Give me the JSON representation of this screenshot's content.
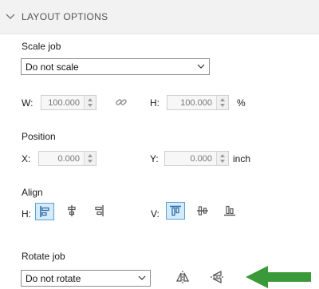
{
  "section": {
    "title": "LAYOUT OPTIONS"
  },
  "scale": {
    "label": "Scale job",
    "select_value": "Do not scale",
    "w_label": "W:",
    "w_value": "100.000",
    "h_label": "H:",
    "h_value": "100.000",
    "unit": "%"
  },
  "position": {
    "label": "Position",
    "x_label": "X:",
    "x_value": "0.000",
    "y_label": "Y:",
    "y_value": "0.000",
    "unit": "inch"
  },
  "align": {
    "label": "Align",
    "h_label": "H:",
    "v_label": "V:"
  },
  "rotate": {
    "label": "Rotate job",
    "select_value": "Do not rotate"
  },
  "colors": {
    "accent": "#3a9a3a",
    "active_fill": "#d6ebfa",
    "icon_blue": "#2f6fa8"
  },
  "icons": {
    "collapse": "chevron-down-icon",
    "link": "chain-link-icon",
    "align_left": "align-left-icon",
    "align_hcenter": "align-horizontal-center-icon",
    "align_right": "align-right-icon",
    "align_top": "align-top-icon",
    "align_vcenter": "align-vertical-center-icon",
    "align_bottom": "align-bottom-icon",
    "flip_horizontal": "flip-horizontal-icon",
    "flip_vertical": "flip-vertical-icon",
    "annotation_arrow": "green-arrow-icon"
  }
}
